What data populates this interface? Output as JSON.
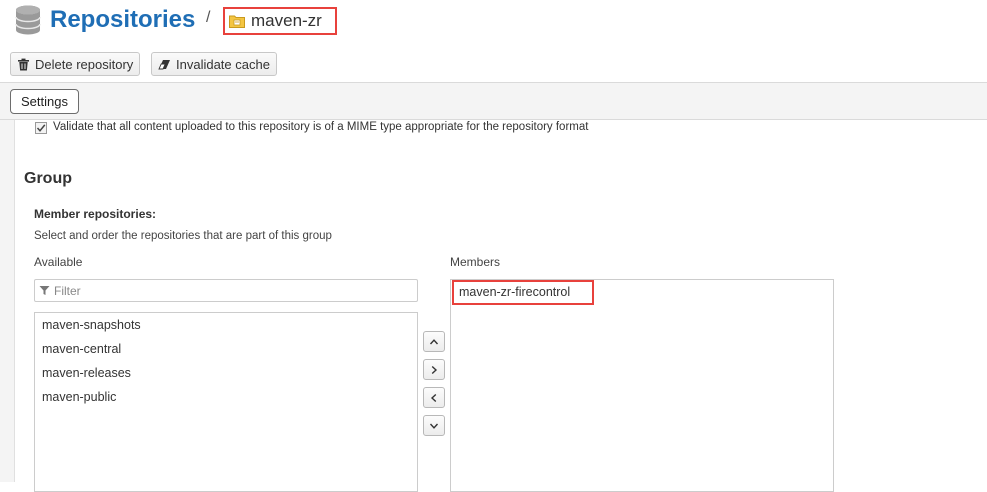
{
  "header": {
    "title": "Repositories",
    "separator": "/",
    "breadcrumb": "maven-zr",
    "icon": "database-icon",
    "breadcrumb_icon": "repository-folder-icon"
  },
  "toolbar": {
    "delete_label": "Delete repository",
    "invalidate_label": "Invalidate cache"
  },
  "tabs": [
    {
      "label": "Settings"
    }
  ],
  "settings": {
    "strict_validation_label": "Validate that all content uploaded to this repository is of a MIME type appropriate for the repository format",
    "strict_validation_checked": true
  },
  "group": {
    "title": "Group",
    "member_label": "Member repositories:",
    "member_help": "Select and order the repositories that are part of this group",
    "available_label": "Available",
    "members_label": "Members",
    "filter_placeholder": "Filter",
    "available": [
      "maven-snapshots",
      "maven-central",
      "maven-releases",
      "maven-public"
    ],
    "members": [
      "maven-zr-firecontrol"
    ]
  },
  "colors": {
    "title_blue": "#1f6eb5",
    "highlight_red": "#e8413c"
  }
}
